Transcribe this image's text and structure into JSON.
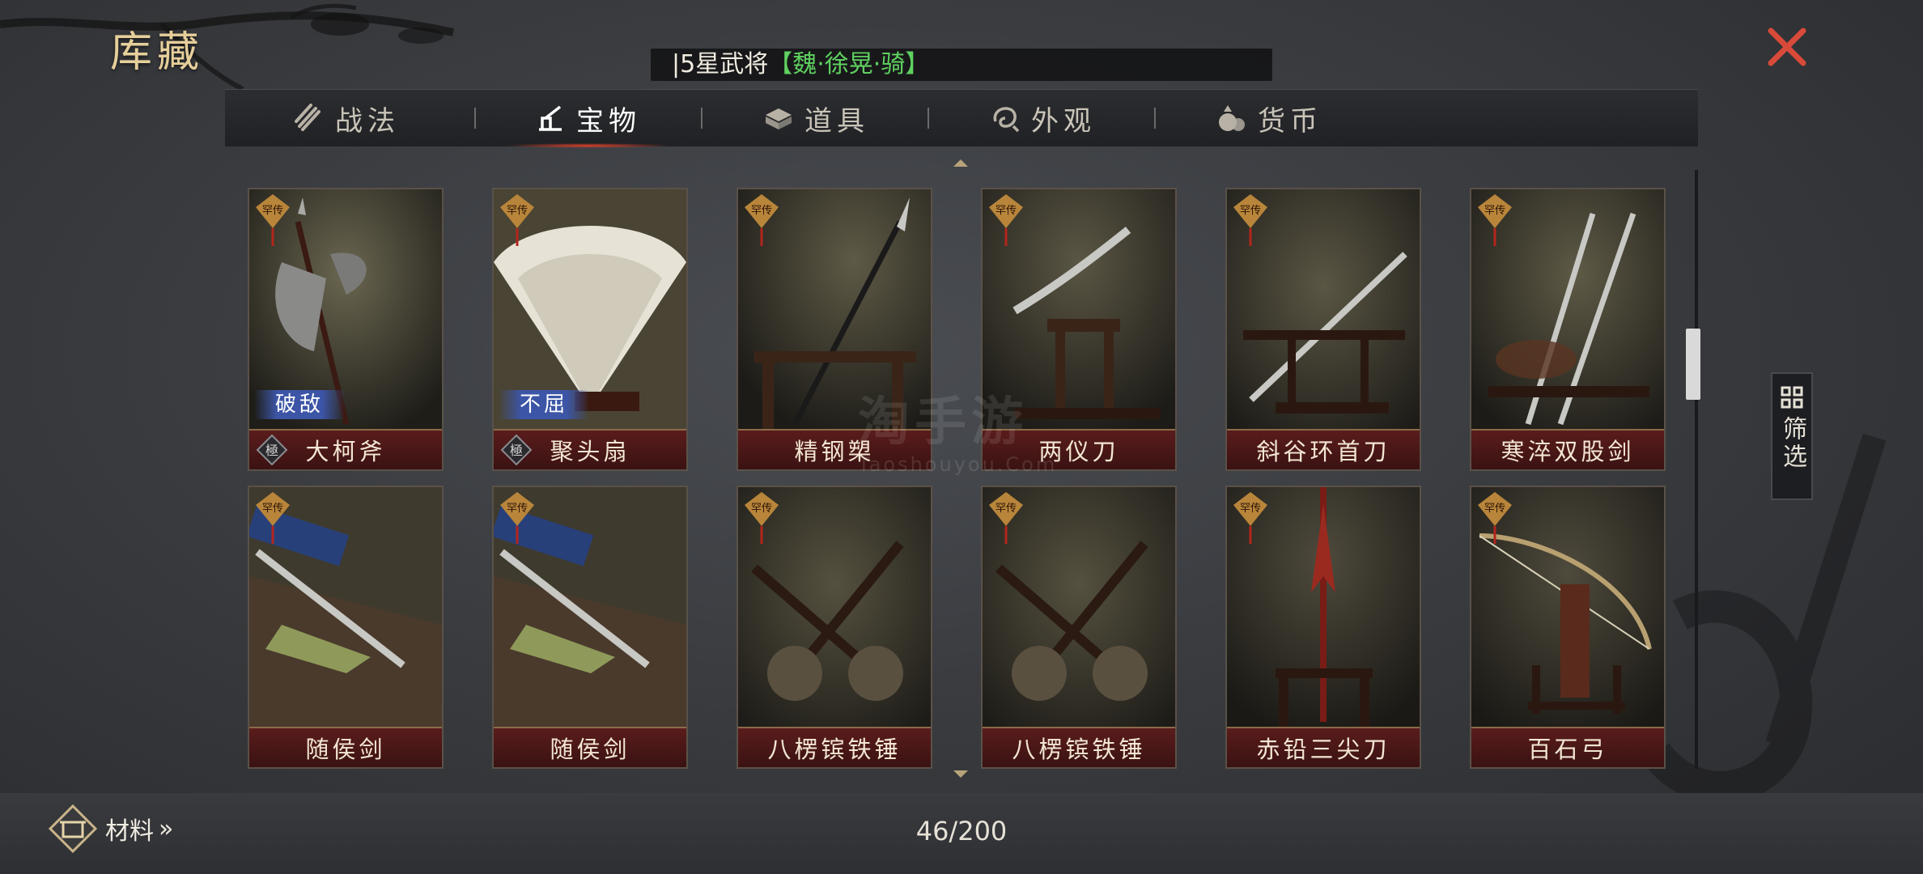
{
  "header": {
    "title": "库藏"
  },
  "marquee": {
    "prefix": "|5星武将",
    "hero": "【魏·徐晃·骑】"
  },
  "tabs": [
    {
      "label": "战法",
      "icon": "scroll-bundle-icon",
      "active": false
    },
    {
      "label": "宝物",
      "icon": "treasure-stand-icon",
      "active": true
    },
    {
      "label": "道具",
      "icon": "chest-icon",
      "active": false
    },
    {
      "label": "外观",
      "icon": "swirl-icon",
      "active": false
    },
    {
      "label": "货币",
      "icon": "money-bag-icon",
      "active": false
    }
  ],
  "items": [
    {
      "name": "大柯斧",
      "rarity": "罕传",
      "skill": "破敌",
      "grade": "極",
      "art": "axe"
    },
    {
      "name": "聚头扇",
      "rarity": "罕传",
      "skill": "不屈",
      "grade": "極",
      "art": "fan"
    },
    {
      "name": "精钢槊",
      "rarity": "罕传",
      "skill": "",
      "grade": "",
      "art": "spear"
    },
    {
      "name": "两仪刀",
      "rarity": "罕传",
      "skill": "",
      "grade": "",
      "art": "curved-blade"
    },
    {
      "name": "斜谷环首刀",
      "rarity": "罕传",
      "skill": "",
      "grade": "",
      "art": "ring-sword"
    },
    {
      "name": "寒淬双股剑",
      "rarity": "罕传",
      "skill": "",
      "grade": "",
      "art": "twin-swords"
    },
    {
      "name": "随侯剑",
      "rarity": "罕传",
      "skill": "",
      "grade": "",
      "art": "sword"
    },
    {
      "name": "随侯剑",
      "rarity": "罕传",
      "skill": "",
      "grade": "",
      "art": "sword"
    },
    {
      "name": "八楞镔铁锤",
      "rarity": "罕传",
      "skill": "",
      "grade": "",
      "art": "hammers"
    },
    {
      "name": "八楞镔铁锤",
      "rarity": "罕传",
      "skill": "",
      "grade": "",
      "art": "hammers"
    },
    {
      "name": "赤铅三尖刀",
      "rarity": "罕传",
      "skill": "",
      "grade": "",
      "art": "trident"
    },
    {
      "name": "百石弓",
      "rarity": "罕传",
      "skill": "",
      "grade": "",
      "art": "bow"
    }
  ],
  "filter": {
    "label": "筛选"
  },
  "bottom": {
    "materials_label": "材料",
    "materials_chevron": "»",
    "capacity": "46/200"
  },
  "watermark": {
    "text": "淘手游",
    "sub": "Taoshouyou.Com"
  },
  "colors": {
    "title": "#e6cf9a",
    "hero": "#5fd15f",
    "close": "#d84a3a",
    "card_bar": "#4a1616",
    "skill_tag": "#3c55a6"
  }
}
